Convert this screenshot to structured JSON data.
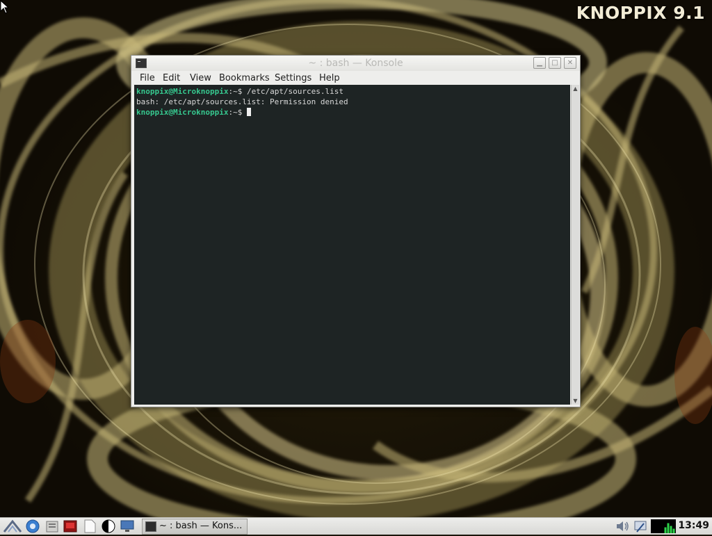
{
  "desktop": {
    "brand": "KNOPPIX 9.1"
  },
  "window": {
    "title": "~ : bash — Konsole",
    "menu": [
      "File",
      "Edit",
      "View",
      "Bookmarks",
      "Settings",
      "Help"
    ],
    "terminal": {
      "lines": [
        {
          "prompt": "knoppix@Microknoppix",
          "suffix": ":~$ ",
          "command": "/etc/apt/sources.list"
        },
        {
          "output": "bash: /etc/apt/sources.list: Permission denied"
        },
        {
          "prompt": "knoppix@Microknoppix",
          "suffix": ":~$ ",
          "command": ""
        }
      ]
    }
  },
  "taskbar": {
    "launchers": [
      "start-menu-icon",
      "browser-icon",
      "file-manager-icon",
      "terminal-launcher-icon",
      "document-icon",
      "contrast-icon",
      "monitor-icon"
    ],
    "task_label": "~ : bash — Kons...",
    "tray": [
      "volume-icon",
      "network-icon",
      "cpu-graph"
    ],
    "clock": "13:49"
  },
  "colors": {
    "terminal_bg": "#1e2424",
    "prompt_user": "#36c78e",
    "terminal_text": "#d9d9d9",
    "window_chrome": "#eeeeec"
  }
}
